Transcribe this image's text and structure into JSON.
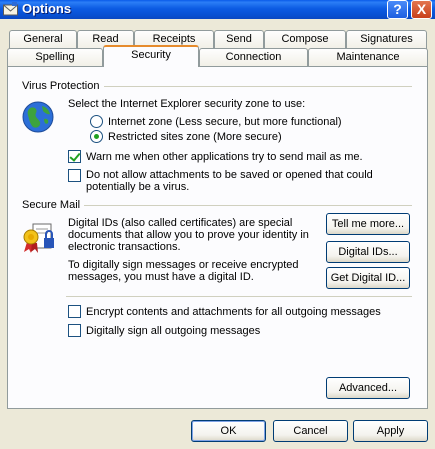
{
  "window": {
    "title": "Options"
  },
  "tabs_row1": [
    "General",
    "Read",
    "Receipts",
    "Send",
    "Compose",
    "Signatures"
  ],
  "tabs_row2": [
    "Spelling",
    "Security",
    "Connection",
    "Maintenance"
  ],
  "active_tab": "Security",
  "virus": {
    "group_label": "Virus Protection",
    "zone_prompt": "Select the Internet Explorer security zone to use:",
    "zone_internet": "Internet zone (Less secure, but more functional)",
    "zone_restricted": "Restricted sites zone (More secure)",
    "warn_label": "Warn me when other applications try to send mail as me.",
    "block_line1": "Do not allow attachments to be saved or opened that could",
    "block_line2": "potentially be a virus."
  },
  "secure": {
    "group_label": "Secure Mail",
    "desc_line1": "Digital IDs (also called certificates) are special",
    "desc_line2": "documents that allow you to prove your identity in",
    "desc_line3": "electronic transactions.",
    "sign_line1": "To digitally sign messages or receive encrypted",
    "sign_line2": "messages, you must have a digital ID.",
    "tell_me_more": "Tell me more...",
    "digital_ids": "Digital IDs...",
    "get_digital_id": "Get Digital ID...",
    "encrypt_label": "Encrypt contents and attachments for all outgoing messages",
    "sign_label": "Digitally sign all outgoing messages"
  },
  "advanced_label": "Advanced...",
  "footer": {
    "ok": "OK",
    "cancel": "Cancel",
    "apply": "Apply"
  },
  "titlebar": {
    "help_glyph": "?",
    "close_glyph": "X"
  },
  "state": {
    "zone_selected": "restricted",
    "warn_checked": true,
    "block_checked": false,
    "encrypt_checked": false,
    "sign_checked": false
  },
  "icons": {
    "app": "envelope-options-icon",
    "virus": "globe-icon",
    "secure": "certificate-icon"
  },
  "colors": {
    "titlebar": "#0A5BE9",
    "active_tab_accent": "#E68B2C",
    "dialog_bg": "#ECE9D8",
    "panel_bg": "#FCFCFE",
    "check_mark": "#21A121"
  }
}
